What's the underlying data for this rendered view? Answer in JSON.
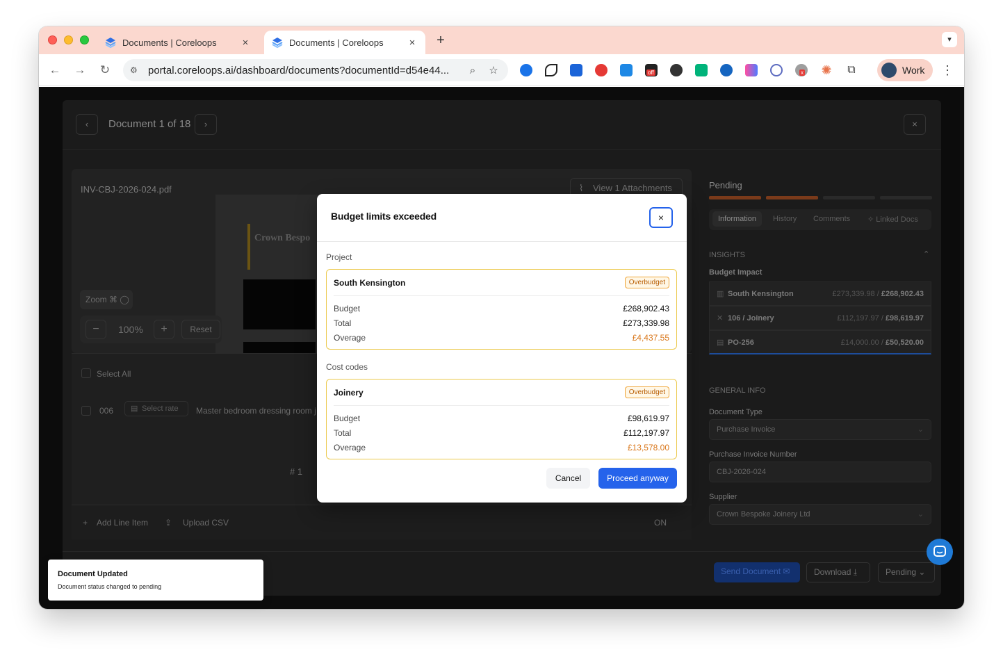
{
  "browser": {
    "tabs": [
      {
        "title": "Documents | Coreloops",
        "active": false
      },
      {
        "title": "Documents | Coreloops",
        "active": true
      }
    ],
    "new_tab": "+",
    "tab_close": "×",
    "url": "portal.coreloops.ai/dashboard/documents?documentId=d54e44...",
    "profile_label": "Work",
    "extension_badge": "off",
    "extension_badge_x": "x",
    "colors": {
      "tabstrip": "#fbd8cf",
      "accent": "#2563eb"
    }
  },
  "drawer": {
    "prev": "‹",
    "next": "›",
    "close": "×",
    "doc_counter": "Document 1 of 18",
    "file_name": "INV-CBJ-2026-024.pdf",
    "attachments_button": "View 1 Attachments",
    "preview_brand": "Crown Bespo",
    "zoom_hint": "Zoom ⌘ ",
    "zoom_minus": "−",
    "zoom_value": "100%",
    "zoom_plus": "+",
    "zoom_reset": "Reset",
    "select_all": "Select All",
    "line_number": "006",
    "select_rate": "Select rate",
    "line_description": "Master bedroom dressing room j",
    "hash_count": "# 1",
    "add_line_item": "Add Line Item",
    "upload_csv": "Upload CSV",
    "on_label": "ON",
    "footer": {
      "send": "Send Document",
      "download": "Download",
      "status": "Pending"
    }
  },
  "side_panel": {
    "status": "Pending",
    "tabs": [
      "Information",
      "History",
      "Comments",
      "Linked Docs"
    ],
    "insights_label": "INSIGHTS",
    "budget_impact_label": "Budget Impact",
    "impact_rows": [
      {
        "name": "South Kensington",
        "total": "£273,339.98",
        "budget": "£268,902.43"
      },
      {
        "name": "106 / Joinery",
        "total": "£112,197.97",
        "budget": "£98,619.97"
      },
      {
        "name": "PO-256",
        "total": "£14,000.00",
        "budget": "£50,520.00"
      }
    ],
    "general_info_label": "GENERAL INFO",
    "doc_type_label": "Document Type",
    "doc_type_value": "Purchase Invoice",
    "invoice_number_label": "Purchase Invoice Number",
    "invoice_number_value": "CBJ-2026-024",
    "supplier_label": "Supplier",
    "supplier_value": "Crown Bespoke Joinery Ltd"
  },
  "modal": {
    "title": "Budget limits exceeded",
    "close": "×",
    "project_section": "Project",
    "project": {
      "name": "South Kensington",
      "badge": "Overbudget",
      "rows": [
        {
          "label": "Budget",
          "value": "£268,902.43"
        },
        {
          "label": "Total",
          "value": "£273,339.98"
        },
        {
          "label": "Overage",
          "value": "£4,437.55"
        }
      ]
    },
    "cost_codes_section": "Cost codes",
    "cost_code": {
      "name": "Joinery",
      "badge": "Overbudget",
      "rows": [
        {
          "label": "Budget",
          "value": "£98,619.97"
        },
        {
          "label": "Total",
          "value": "£112,197.97"
        },
        {
          "label": "Overage",
          "value": "£13,578.00"
        }
      ]
    },
    "cancel": "Cancel",
    "proceed": "Proceed anyway"
  },
  "toast": {
    "title": "Document Updated",
    "description": "Document status changed to pending"
  }
}
